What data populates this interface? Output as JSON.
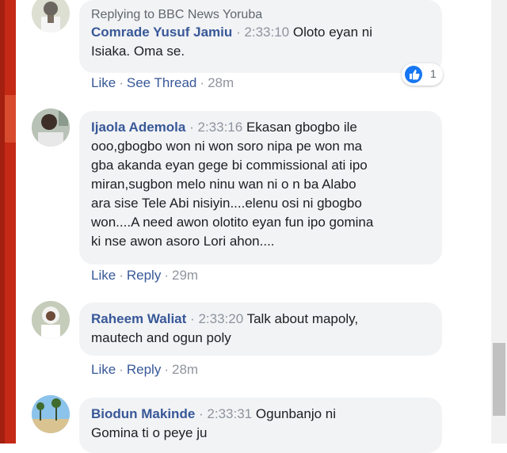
{
  "comments": [
    {
      "reply_to": "Replying to BBC News Yoruba",
      "author": "Comrade Yusuf Jamiu",
      "sep": "·",
      "time": "2:33:10",
      "lines": [
        "Oloto eyan ni",
        "Isiaka. Oma se."
      ],
      "actions": [
        "Like",
        "See Thread"
      ],
      "age": "28m",
      "reactions": {
        "icon": "like-icon",
        "count": "1"
      }
    },
    {
      "author": "Ijaola Ademola",
      "sep": "·",
      "time": "2:33:16",
      "lines": [
        "Ekasan gbogbo ile",
        "ooo,gbogbo won ni won soro nipa pe won ma",
        "gba akanda eyan gege bi commissional ati ipo",
        "miran,sugbon melo ninu wan ni o n ba Alabo",
        "ara sise Tele Abi nisiyin....elenu osi ni gbogbo",
        "won....A need awon olotito eyan fun ipo gomina",
        "ki nse awon asoro Lori ahon...."
      ],
      "actions": [
        "Like",
        "Reply"
      ],
      "age": "29m"
    },
    {
      "author": "Raheem Waliat",
      "sep": "·",
      "time": "2:33:20",
      "lines": [
        "Talk about mapoly,",
        "mautech and ogun poly"
      ],
      "actions": [
        "Like",
        "Reply"
      ],
      "age": "28m"
    },
    {
      "author": "Biodun Makinde",
      "sep": "·",
      "time": "2:33:31",
      "lines": [
        "Ogunbanjo ni",
        "Gomina ti o peye ju"
      ]
    }
  ],
  "colors": {
    "name": "#385898",
    "bubble": "#f2f3f5",
    "meta": "#90949c",
    "like_blue": "#1877f2"
  }
}
